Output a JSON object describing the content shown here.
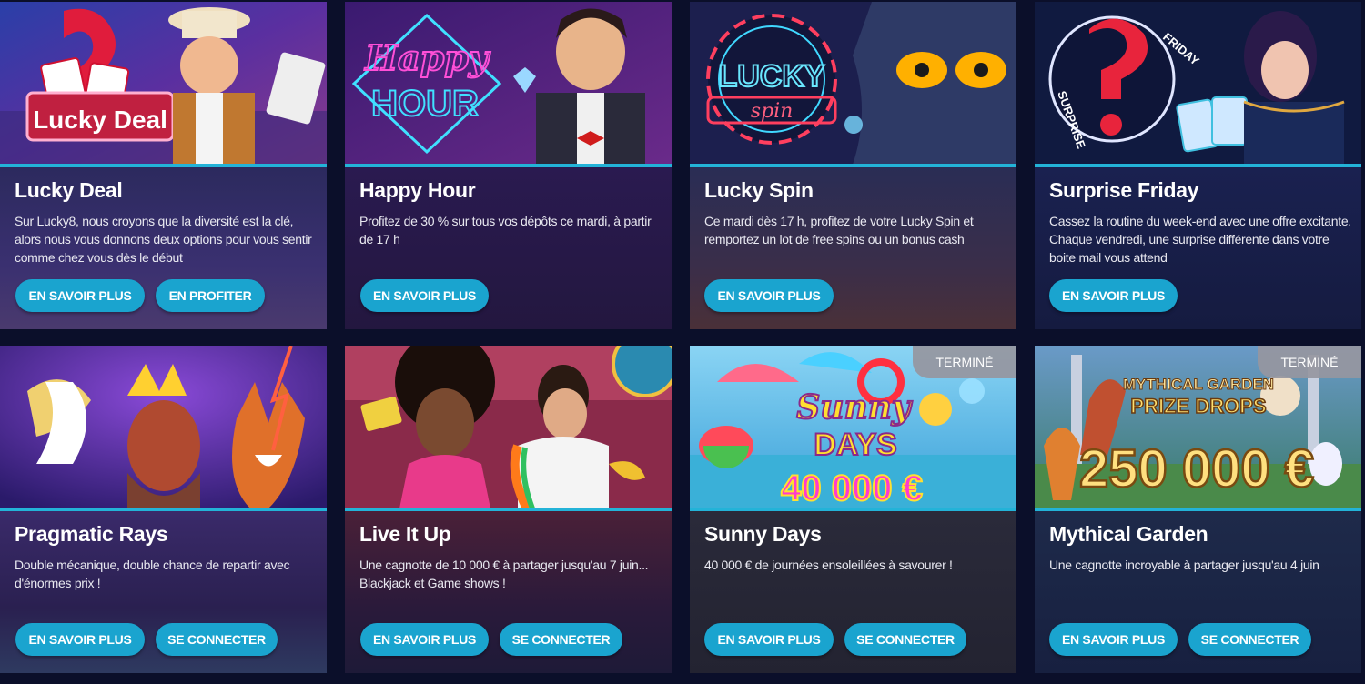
{
  "colors": {
    "accent": "#1aa4cf",
    "strip": "#23b3d8",
    "background": "#0b0f2a"
  },
  "cards": [
    {
      "title": "Lucky Deal",
      "description": "Sur Lucky8, nous croyons que la diversité est la clé, alors nous vous donnons deux options pour vous sentir comme chez vous dès le début",
      "banner_text": "Lucky Deal",
      "buttons": [
        "EN SAVOIR PLUS",
        "EN PROFITER"
      ]
    },
    {
      "title": "Happy Hour",
      "description": "Profitez de 30 % sur tous vos dépôts ce mardi, à partir de 17 h",
      "banner_text": [
        "Happy",
        "HOUR"
      ],
      "buttons": [
        "EN SAVOIR PLUS"
      ]
    },
    {
      "title": "Lucky Spin",
      "description": "Ce mardi dès 17 h, profitez de votre Lucky Spin et remportez un lot de free spins ou un bonus cash",
      "banner_text": [
        "LUCKY",
        "spin"
      ],
      "buttons": [
        "EN SAVOIR PLUS"
      ]
    },
    {
      "title": "Surprise Friday",
      "description": "Cassez la routine du week-end avec une offre excitante. Chaque vendredi, une surprise différente dans votre boite mail vous attend",
      "banner_text": [
        "FRIDAY",
        "SURPRISE"
      ],
      "buttons": [
        "EN SAVOIR PLUS"
      ]
    },
    {
      "title": "Pragmatic Rays",
      "description": "Double mécanique, double chance de repartir avec d'énormes prix !",
      "buttons": [
        "EN SAVOIR PLUS",
        "SE CONNECTER"
      ]
    },
    {
      "title": "Live It Up",
      "description": "Une cagnotte de 10 000 € à partager jusqu'au 7 juin... Blackjack et Game shows !",
      "buttons": [
        "EN SAVOIR PLUS",
        "SE CONNECTER"
      ]
    },
    {
      "title": "Sunny Days",
      "description": "40 000 € de journées ensoleillées à savourer !",
      "banner_text": [
        "Sunny",
        "DAYS",
        "40 000 €"
      ],
      "badge": "TERMINÉ",
      "buttons": [
        "EN SAVOIR PLUS",
        "SE CONNECTER"
      ]
    },
    {
      "title": "Mythical Garden",
      "description": "Une cagnotte incroyable à partager jusqu'au 4 juin",
      "banner_text": [
        "MYTHICAL GARDEN",
        "PRIZE DROPS",
        "250 000 €"
      ],
      "badge": "TERMINÉ",
      "buttons": [
        "EN SAVOIR PLUS",
        "SE CONNECTER"
      ]
    }
  ]
}
